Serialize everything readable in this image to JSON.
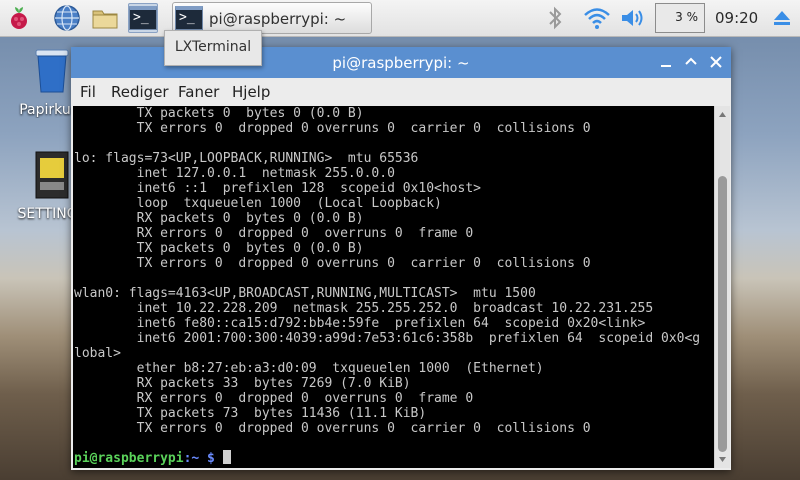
{
  "taskbar": {
    "task_button_label": "pi@raspberrypi: ~",
    "cpu_usage": "3 %",
    "clock": "09:20"
  },
  "desktop": {
    "items": [
      {
        "label": "Papirkurv"
      },
      {
        "label": "SETTINGS"
      }
    ]
  },
  "tooltip": "LXTerminal",
  "window": {
    "title": "pi@raspberrypi: ~",
    "menu": [
      "Fil",
      "Rediger",
      "Faner",
      "Hjelp"
    ]
  },
  "terminal": {
    "lines": [
      "        TX packets 0  bytes 0 (0.0 B)",
      "        TX errors 0  dropped 0 overruns 0  carrier 0  collisions 0",
      "",
      "lo: flags=73<UP,LOOPBACK,RUNNING>  mtu 65536",
      "        inet 127.0.0.1  netmask 255.0.0.0",
      "        inet6 ::1  prefixlen 128  scopeid 0x10<host>",
      "        loop  txqueuelen 1000  (Local Loopback)",
      "        RX packets 0  bytes 0 (0.0 B)",
      "        RX errors 0  dropped 0  overruns 0  frame 0",
      "        TX packets 0  bytes 0 (0.0 B)",
      "        TX errors 0  dropped 0 overruns 0  carrier 0  collisions 0",
      "",
      "wlan0: flags=4163<UP,BROADCAST,RUNNING,MULTICAST>  mtu 1500",
      "        inet 10.22.228.209  netmask 255.255.252.0  broadcast 10.22.231.255",
      "        inet6 fe80::ca15:d792:bb4e:59fe  prefixlen 64  scopeid 0x20<link>",
      "        inet6 2001:700:300:4039:a99d:7e53:61c6:358b  prefixlen 64  scopeid 0x0<g",
      "lobal>",
      "        ether b8:27:eb:a3:d0:09  txqueuelen 1000  (Ethernet)",
      "        RX packets 33  bytes 7269 (7.0 KiB)",
      "        RX errors 0  dropped 0  overruns 0  frame 0",
      "        TX packets 73  bytes 11436 (11.1 KiB)",
      "        TX errors 0  dropped 0 overruns 0  carrier 0  collisions 0"
    ],
    "prompt_user": "pi@raspberrypi",
    "prompt_path": ":~ $ "
  },
  "colors": {
    "titlebar": "#5a8fd0",
    "prompt_user": "#5ad25a",
    "prompt_path": "#6b8cff"
  }
}
